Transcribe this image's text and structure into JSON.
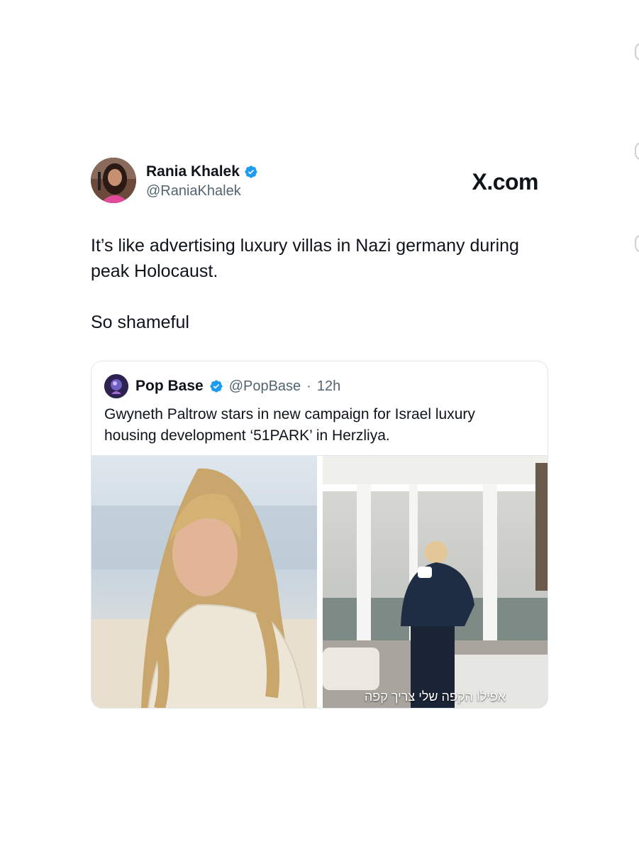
{
  "author": {
    "name": "Rania Khalek",
    "handle": "@RaniaKhalek",
    "verified": true,
    "avatar_icon": "profile-photo"
  },
  "brand": {
    "label": "X.com"
  },
  "tweet": {
    "paragraphs": [
      "It’s like advertising luxury villas in Nazi germany during peak Holocaust.",
      "So shameful"
    ]
  },
  "quote": {
    "name": "Pop Base",
    "handle": "@PopBase",
    "separator": "·",
    "time": "12h",
    "verified": true,
    "text": "Gwyneth Paltrow stars in new campaign for Israel luxury housing development ‘51PARK’ in Herzliya.",
    "media": [
      {
        "alt_icon": "portrait-photo"
      },
      {
        "alt_icon": "interior-photo",
        "subtitle": "אפילו הקפה שלי צריך קפה"
      }
    ]
  },
  "colors": {
    "verified": "#1d9bf0",
    "text": "#0f1419",
    "secondary": "#536471",
    "border": "#e1e8ed"
  }
}
